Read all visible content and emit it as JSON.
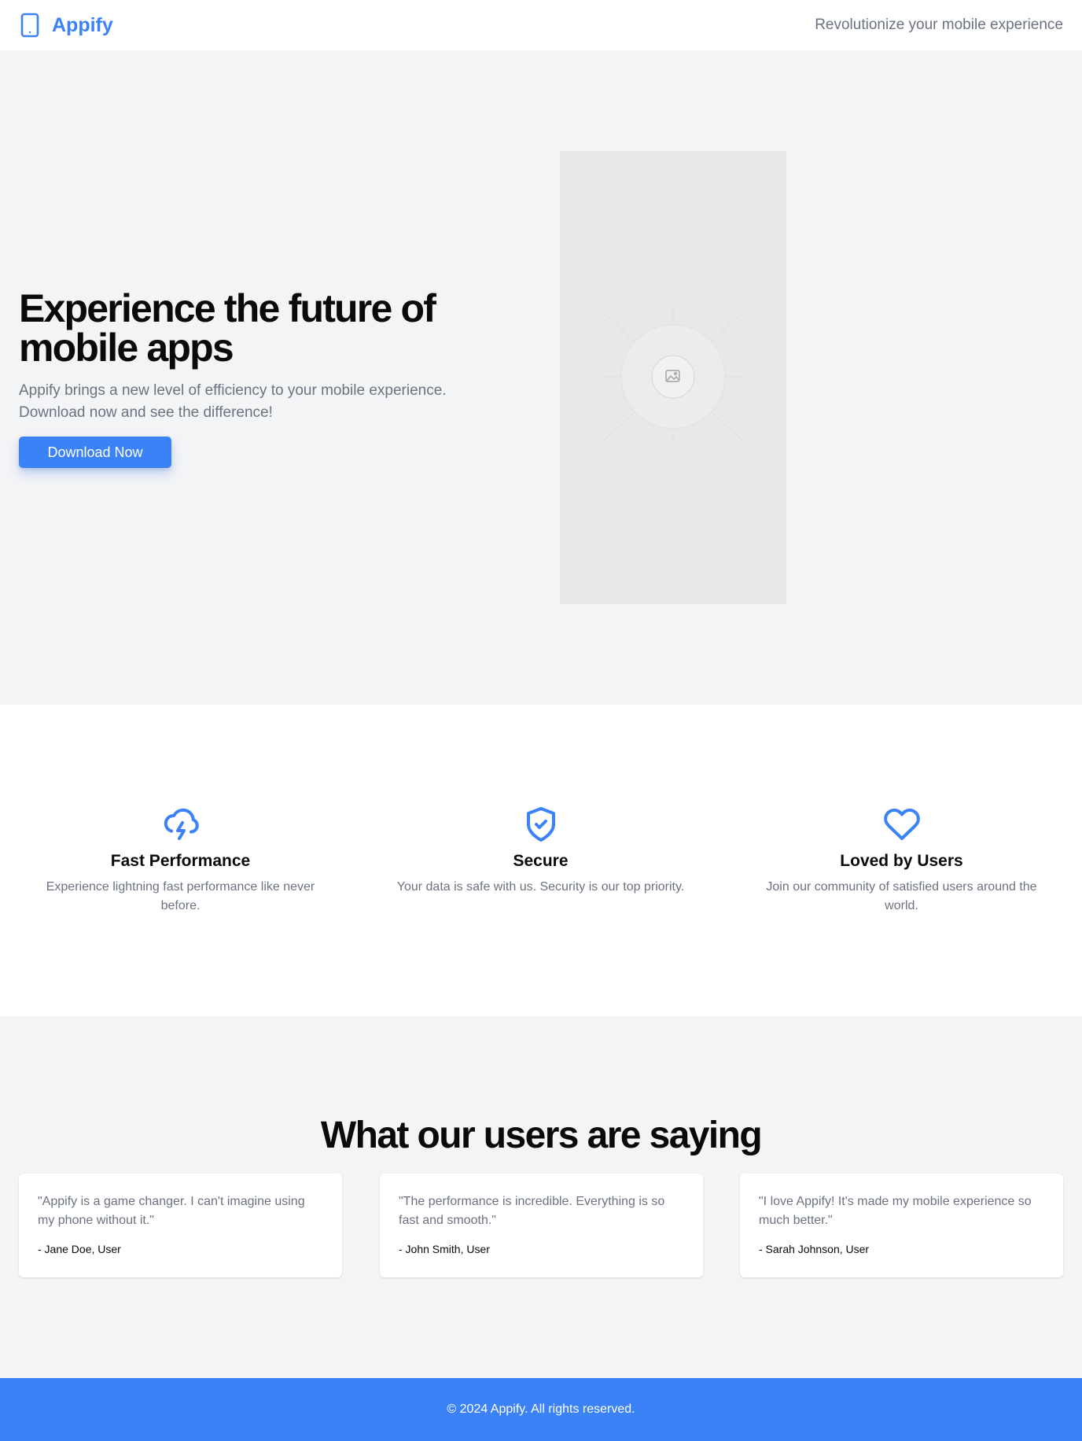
{
  "colors": {
    "accent": "#3b82f6",
    "hero_background": "#f3f4f6",
    "muted_text": "#6b7280",
    "footer_background": "#3b82f6"
  },
  "header": {
    "brand_icon": "tablet-icon",
    "brand_name": "Appify",
    "tagline": "Revolutionize your mobile experience"
  },
  "hero": {
    "title": "Experience the future of mobile apps",
    "subtitle": "Appify brings a new level of efficiency to your mobile experience. Download now and see the difference!",
    "button_label": "Download Now",
    "image_icon": "image-placeholder-icon"
  },
  "features": [
    {
      "icon": "cloud-lightning-icon",
      "title": "Fast Performance",
      "description": "Experience lightning fast performance like never before."
    },
    {
      "icon": "shield-check-icon",
      "title": "Secure",
      "description": "Your data is safe with us. Security is our top priority."
    },
    {
      "icon": "heart-icon",
      "title": "Loved by Users",
      "description": "Join our community of satisfied users around the world."
    }
  ],
  "testimonials": {
    "title": "What our users are saying",
    "items": [
      {
        "quote": "\"Appify is a game changer. I can't imagine using my phone without it.\"",
        "author": "- Jane Doe, User"
      },
      {
        "quote": "\"The performance is incredible. Everything is so fast and smooth.\"",
        "author": "- John Smith, User"
      },
      {
        "quote": "\"I love Appify! It's made my mobile experience so much better.\"",
        "author": "- Sarah Johnson, User"
      }
    ]
  },
  "footer": {
    "text": "© 2024 Appify. All rights reserved."
  }
}
